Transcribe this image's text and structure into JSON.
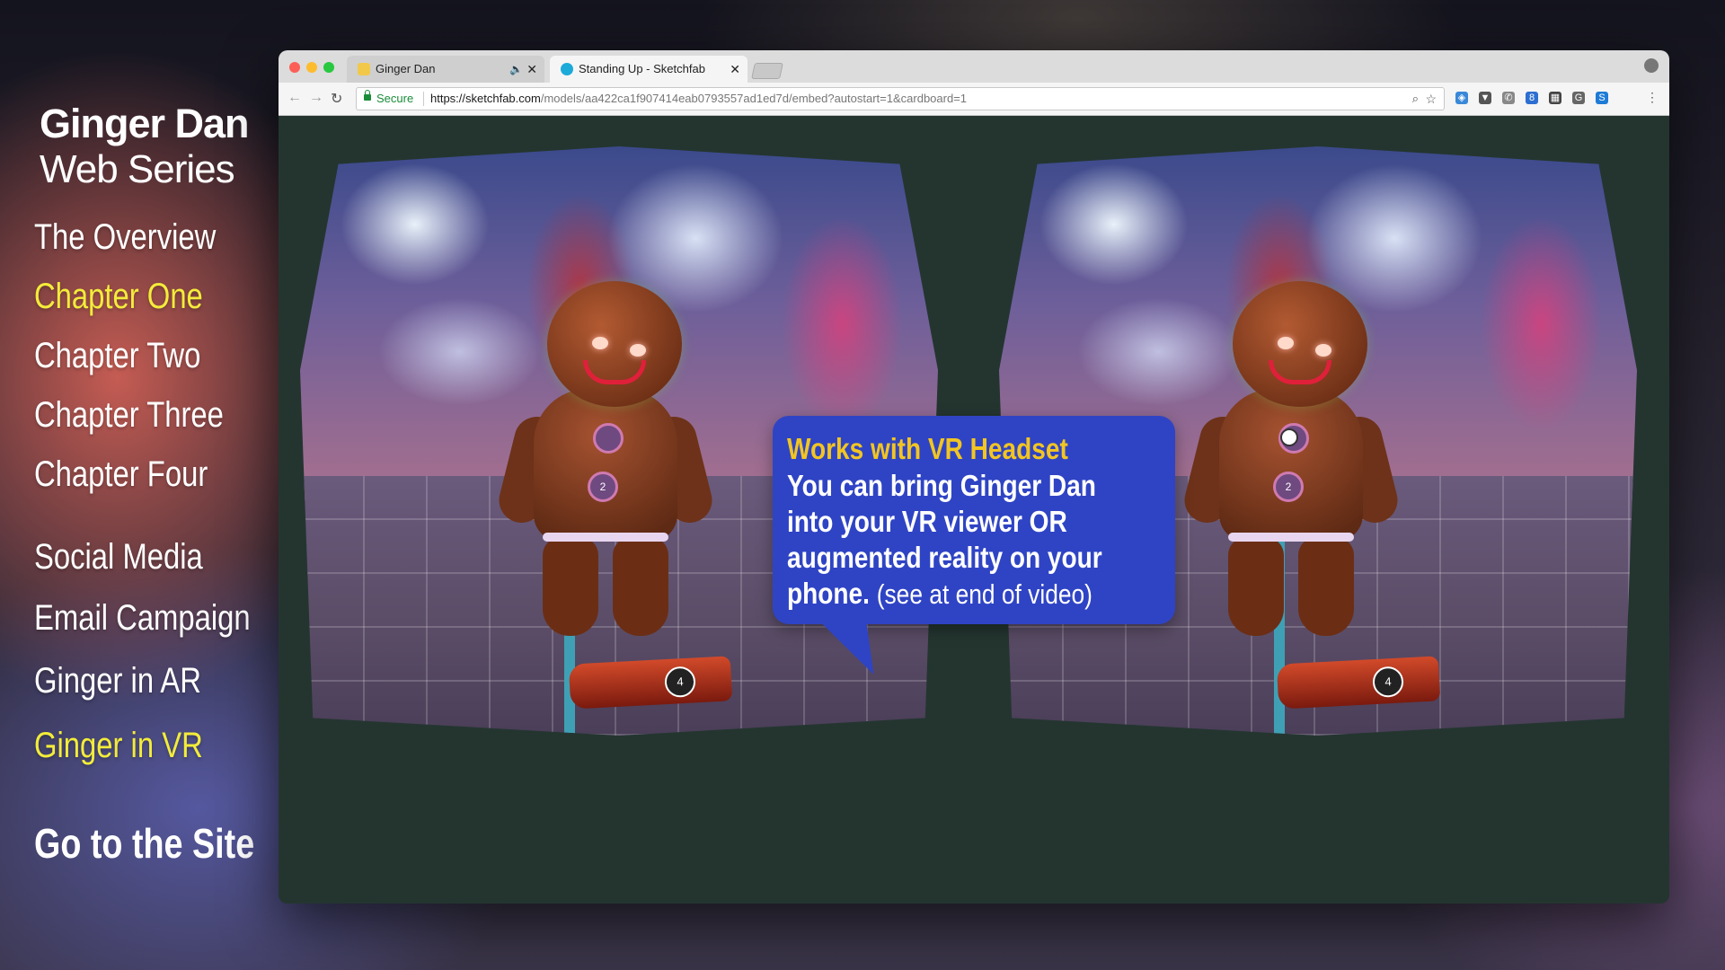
{
  "sidebar": {
    "title": "Ginger Dan",
    "subtitle": "Web Series",
    "items": [
      {
        "label": "The Overview",
        "active": false
      },
      {
        "label": "Chapter One",
        "active": true
      },
      {
        "label": "Chapter Two",
        "active": false
      },
      {
        "label": "Chapter Three",
        "active": false
      },
      {
        "label": "Chapter Four",
        "active": false
      },
      {
        "label": "Social Media",
        "active": false
      },
      {
        "label": "Email Campaign",
        "active": false
      },
      {
        "label": "Ginger in AR",
        "active": false
      },
      {
        "label": "Ginger in VR",
        "active": true
      }
    ],
    "site_link": "Go to the Site",
    "active_color": "#f3ec3a"
  },
  "browser": {
    "tabs": [
      {
        "title": "Ginger Dan",
        "favicon": "ginger-favicon-icon",
        "audio_icon": "🔈",
        "close_icon": "✕"
      },
      {
        "title": "Standing Up - Sketchfab",
        "favicon": "sketchfab-favicon-icon",
        "close_icon": "✕"
      }
    ],
    "toolbar": {
      "back": "←",
      "forward": "→",
      "reload": "↻",
      "secure_label": "Secure",
      "url_host": "https://sketchfab.com",
      "url_path": "/models/aa422ca1f907414eab0793557ad1ed7d/embed?autostart=1&cardboard=1",
      "zoom_icon": "⌕",
      "star_icon": "☆",
      "menu_icon": "⋮",
      "extension_glyphs": [
        "◈",
        "▼",
        "✆",
        "8",
        "▦",
        "G",
        "S"
      ]
    }
  },
  "viewport": {
    "button_numbers": [
      "2",
      "4"
    ]
  },
  "callout": {
    "heading": "Works with VR Headset",
    "lines": [
      "You can bring Ginger Dan",
      "into your VR viewer OR",
      "augmented reality on your",
      "phone."
    ],
    "note": "(see at end of video)",
    "background": "#2f44c4",
    "heading_color": "#f2c522"
  }
}
